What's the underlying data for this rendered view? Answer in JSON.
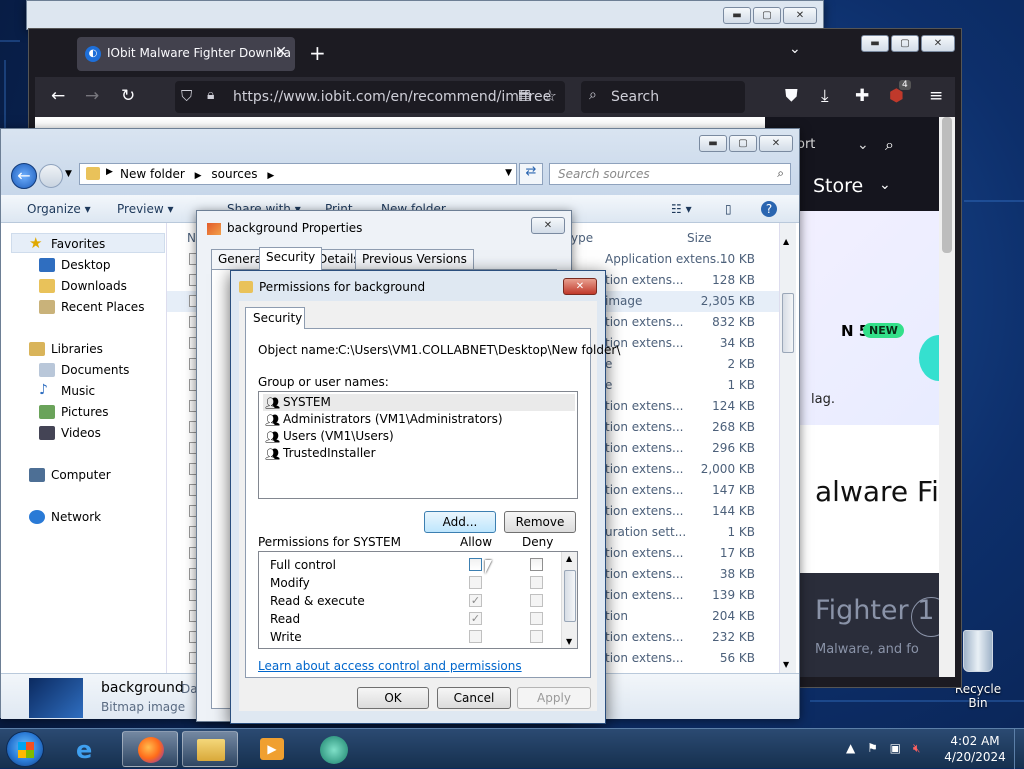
{
  "firefox": {
    "tab_title": "IObit Malware Fighter Downloa",
    "tab_close": "✕",
    "new_tab": "+",
    "url": "https://www.iobit.com/en/recommend/imffree",
    "search_placeholder": "Search",
    "extension_badge": "4"
  },
  "website": {
    "sort_label": "ort",
    "store_label": "Store",
    "badge_text": "N 5",
    "new_label": "NEW",
    "lag_text": "lag.",
    "heading": "alware Figh",
    "dark_heading": "Fighter 1",
    "dark_sub": "Malware, and fo"
  },
  "explorer": {
    "breadcrumb": [
      "New folder",
      "sources"
    ],
    "search_placeholder": "Search sources",
    "toolbar": {
      "organize": "Organize",
      "preview": "Preview",
      "share": "Share with",
      "print": "Print",
      "new_folder": "New folder"
    },
    "nav": {
      "favorites": "Favorites",
      "desktop": "Desktop",
      "downloads": "Downloads",
      "recent": "Recent Places",
      "libraries": "Libraries",
      "documents": "Documents",
      "music": "Music",
      "pictures": "Pictures",
      "videos": "Videos",
      "computer": "Computer",
      "network": "Network"
    },
    "columns": {
      "name": "N",
      "type": "ype",
      "size": "Size"
    },
    "files": [
      {
        "type": "Application extens...",
        "size": "10 KB"
      },
      {
        "type": "tion extens...",
        "size": "128 KB"
      },
      {
        "type": "image",
        "size": "2,305 KB"
      },
      {
        "type": "tion extens...",
        "size": "832 KB"
      },
      {
        "type": "tion extens...",
        "size": "34 KB"
      },
      {
        "type": "e",
        "size": "2 KB"
      },
      {
        "type": "e",
        "size": "1 KB"
      },
      {
        "type": "tion extens...",
        "size": "124 KB"
      },
      {
        "type": "tion extens...",
        "size": "268 KB"
      },
      {
        "type": "tion extens...",
        "size": "296 KB"
      },
      {
        "type": "tion extens...",
        "size": "2,000 KB"
      },
      {
        "type": "tion extens...",
        "size": "147 KB"
      },
      {
        "type": "tion extens...",
        "size": "144 KB"
      },
      {
        "type": "uration sett...",
        "size": "1 KB"
      },
      {
        "type": "tion extens...",
        "size": "17 KB"
      },
      {
        "type": "tion extens...",
        "size": "38 KB"
      },
      {
        "type": "tion extens...",
        "size": "139 KB"
      },
      {
        "type": "tion",
        "size": "204 KB"
      },
      {
        "type": "tion extens...",
        "size": "232 KB"
      },
      {
        "type": "tion extens...",
        "size": "56 KB"
      }
    ],
    "details": {
      "name": "background",
      "kind": "Bitmap image",
      "date_label": "Da"
    }
  },
  "properties": {
    "title": "background Properties",
    "tabs": [
      "General",
      "Security",
      "Details",
      "Previous Versions"
    ]
  },
  "permissions": {
    "title": "Permissions for background",
    "tab": "Security",
    "object_name_label": "Object name:",
    "object_name_value": "C:\\Users\\VM1.COLLABNET\\Desktop\\New folder\\",
    "group_label": "Group or user names:",
    "groups": [
      "SYSTEM",
      "Administrators (VM1\\Administrators)",
      "Users (VM1\\Users)",
      "TrustedInstaller"
    ],
    "add_button": "Add...",
    "remove_button": "Remove",
    "perm_for_label": "Permissions for SYSTEM",
    "allow_header": "Allow",
    "deny_header": "Deny",
    "perm_rows": [
      {
        "name": "Full control",
        "allow": false,
        "deny": false
      },
      {
        "name": "Modify",
        "allow": false,
        "deny": false
      },
      {
        "name": "Read & execute",
        "allow": true,
        "deny": false
      },
      {
        "name": "Read",
        "allow": true,
        "deny": false
      },
      {
        "name": "Write",
        "allow": false,
        "deny": false
      }
    ],
    "link": "Learn about access control and permissions",
    "ok": "OK",
    "cancel": "Cancel",
    "apply": "Apply"
  },
  "desktop": {
    "recycle_bin": "Recycle Bin"
  },
  "taskbar": {
    "time": "4:02 AM",
    "date": "4/20/2024"
  }
}
